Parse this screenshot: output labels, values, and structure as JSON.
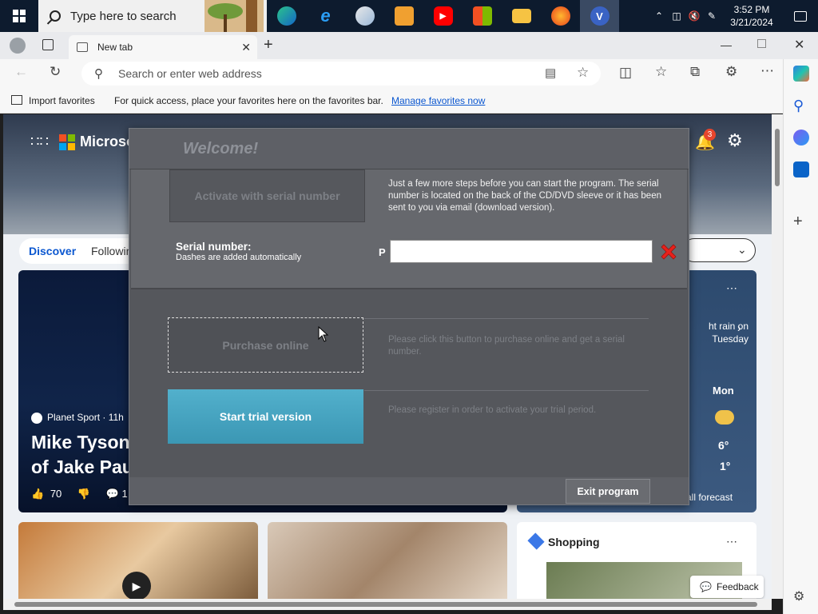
{
  "taskbar": {
    "search_placeholder": "Type here to search",
    "apps": [
      "edge-icon",
      "ie-icon",
      "paint-icon",
      "media-icon",
      "youtube-icon",
      "store-icon",
      "explorer-icon",
      "firefox-icon",
      "v-app-icon"
    ],
    "v_app_letter": "V",
    "clock_time": "3:52 PM",
    "clock_date": "3/21/2024"
  },
  "browser": {
    "tab_title": "New tab",
    "address_placeholder": "Search or enter web address",
    "favbar": {
      "import": "Import favorites",
      "hint": "For quick access, place your favorites here on the favorites bar.",
      "manage": "Manage favorites now"
    }
  },
  "page": {
    "brand": "Microsoft",
    "notif_count": "3",
    "tabs": {
      "discover": "Discover",
      "following": "Following"
    },
    "news": {
      "source": "Planet Sport · 11h",
      "headline_line1": "Mike Tyson",
      "headline_line2": "of Jake Pau",
      "likes": "70",
      "comments": "1"
    },
    "weather": {
      "summary_line1": "ht rain on",
      "summary_line2": "Tuesday",
      "day": "Mon",
      "high": "6°",
      "low": "1°",
      "forecast_link": "all forecast"
    },
    "shopping_title": "Shopping",
    "feedback": "Feedback"
  },
  "dialog": {
    "title": "Welcome!",
    "activate_label": "Activate with serial number",
    "serial_description": "Just a few more steps before you can start the program. The serial number is located on the back of the CD/DVD sleeve or it has been sent to you via email (download version).",
    "serial_label": "Serial number:",
    "serial_hint": "Dashes are added automatically",
    "serial_prefix": "P",
    "serial_value": "",
    "purchase_label": "Purchase online",
    "purchase_description": "Please click this button to purchase online and get a serial number.",
    "trial_label": "Start trial version",
    "trial_description": "Please register in order to activate your trial period.",
    "exit_label": "Exit program"
  },
  "colors": {
    "dialog_bg": "#55575c",
    "trial_accent": "#3b97b4",
    "clear_icon": "#e8211b",
    "link": "#0b57d0"
  }
}
